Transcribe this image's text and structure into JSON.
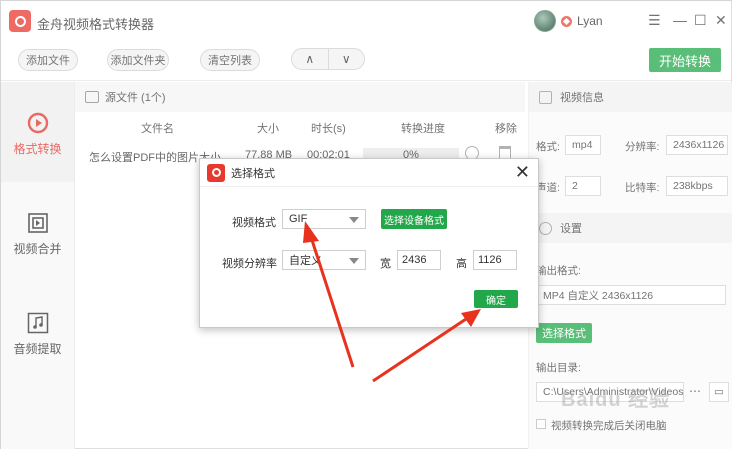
{
  "app": {
    "title": "金舟视频格式转换器"
  },
  "user": {
    "name": "Lyan"
  },
  "window_controls": {
    "menu": "☰",
    "minimize": "—",
    "maximize": "☐",
    "close": "✕"
  },
  "toolbar": {
    "add_file": "添加文件",
    "add_folder": "添加文件夹",
    "clear_list": "清空列表",
    "move_up": "∧",
    "move_down": "∨",
    "start": "开始转换"
  },
  "sidebar": {
    "items": [
      {
        "label": "格式转换",
        "icon": "convert-icon",
        "active": true
      },
      {
        "label": "视频合并",
        "icon": "merge-icon",
        "active": false
      },
      {
        "label": "音频提取",
        "icon": "music-icon",
        "active": false
      }
    ]
  },
  "filelist": {
    "header": "源文件 (1个)",
    "columns": [
      "文件名",
      "大小",
      "时长(s)",
      "转换进度",
      "移除"
    ],
    "rows": [
      {
        "name": "怎么设置PDF中的图片大小",
        "size": "77.88 MB",
        "duration": "00:02:01",
        "progress": "0%"
      }
    ]
  },
  "video_info": {
    "title": "视频信息",
    "format_label": "格式:",
    "format_value": "mp4",
    "resolution_label": "分辨率:",
    "resolution_value": "2436x1126",
    "channel_label": "声道:",
    "channel_value": "2",
    "bitrate_label": "比特率:",
    "bitrate_value": "238kbps"
  },
  "settings": {
    "title": "设置",
    "output_format_label": "输出格式:",
    "output_format_value": "MP4 自定义 2436x1126",
    "choose_format_button": "选择格式",
    "output_dir_label": "输出目录:",
    "output_dir_value": "C:\\Users\\Administrator\\Videos",
    "close_after_label": "视频转换完成后关闭电脑"
  },
  "dialog": {
    "title": "选择格式",
    "video_format_label": "视频格式",
    "video_format_value": "GIF",
    "choose_device_button": "选择设备格式",
    "resolution_label": "视频分辨率",
    "resolution_value": "自定义",
    "width_label": "宽",
    "width_value": "2436",
    "height_label": "高",
    "height_value": "1126",
    "ok_button": "确定",
    "close": "✕"
  },
  "colors": {
    "accent_red": "#e0392f",
    "green": "#22a84a",
    "arrow_red": "#e8321e"
  },
  "watermark": "Baidu 经验"
}
